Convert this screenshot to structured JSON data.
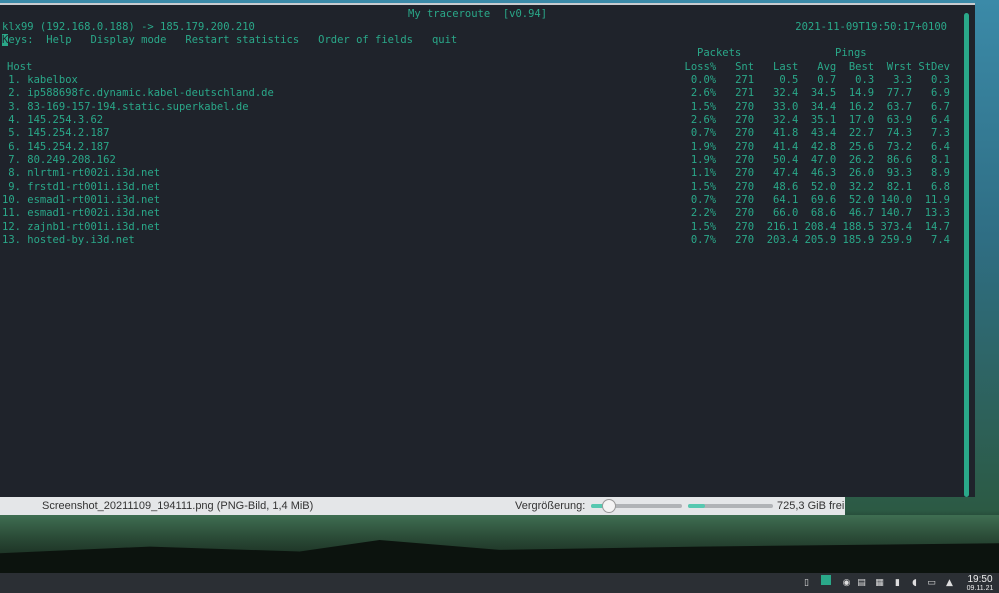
{
  "terminal": {
    "title": "My traceroute  [v0.94]",
    "route": "klx99 (192.168.0.188) -> 185.179.200.210",
    "timestamp": "2021-11-09T19:50:17+0100",
    "keys_cursor": "K",
    "keys_label": "eys:",
    "keys": [
      "Help",
      "Display mode",
      "Restart statistics",
      "Order of fields",
      "quit"
    ],
    "group_headers": {
      "packets": "Packets",
      "pings": "Pings"
    },
    "columns": {
      "host": "Host",
      "loss": "Loss%",
      "snt": "Snt",
      "last": "Last",
      "avg": "Avg",
      "best": "Best",
      "wrst": "Wrst",
      "stdev": "StDev"
    },
    "rows": [
      {
        "n": "1.",
        "host": "kabelbox",
        "loss": "0.0%",
        "snt": "271",
        "last": "0.5",
        "avg": "0.7",
        "best": "0.3",
        "wrst": "3.3",
        "stdev": "0.3"
      },
      {
        "n": "2.",
        "host": "ip588698fc.dynamic.kabel-deutschland.de",
        "loss": "2.6%",
        "snt": "271",
        "last": "32.4",
        "avg": "34.5",
        "best": "14.9",
        "wrst": "77.7",
        "stdev": "6.9"
      },
      {
        "n": "3.",
        "host": "83-169-157-194.static.superkabel.de",
        "loss": "1.5%",
        "snt": "270",
        "last": "33.0",
        "avg": "34.4",
        "best": "16.2",
        "wrst": "63.7",
        "stdev": "6.7"
      },
      {
        "n": "4.",
        "host": "145.254.3.62",
        "loss": "2.6%",
        "snt": "270",
        "last": "32.4",
        "avg": "35.1",
        "best": "17.0",
        "wrst": "63.9",
        "stdev": "6.4"
      },
      {
        "n": "5.",
        "host": "145.254.2.187",
        "loss": "0.7%",
        "snt": "270",
        "last": "41.8",
        "avg": "43.4",
        "best": "22.7",
        "wrst": "74.3",
        "stdev": "7.3"
      },
      {
        "n": "6.",
        "host": "145.254.2.187",
        "loss": "1.9%",
        "snt": "270",
        "last": "41.4",
        "avg": "42.8",
        "best": "25.6",
        "wrst": "73.2",
        "stdev": "6.4"
      },
      {
        "n": "7.",
        "host": "80.249.208.162",
        "loss": "1.9%",
        "snt": "270",
        "last": "50.4",
        "avg": "47.0",
        "best": "26.2",
        "wrst": "86.6",
        "stdev": "8.1"
      },
      {
        "n": "8.",
        "host": "nlrtm1-rt002i.i3d.net",
        "loss": "1.1%",
        "snt": "270",
        "last": "47.4",
        "avg": "46.3",
        "best": "26.0",
        "wrst": "93.3",
        "stdev": "8.9"
      },
      {
        "n": "9.",
        "host": "frstd1-rt001i.i3d.net",
        "loss": "1.5%",
        "snt": "270",
        "last": "48.6",
        "avg": "52.0",
        "best": "32.2",
        "wrst": "82.1",
        "stdev": "6.8"
      },
      {
        "n": "10.",
        "host": "esmad1-rt001i.i3d.net",
        "loss": "0.7%",
        "snt": "270",
        "last": "64.1",
        "avg": "69.6",
        "best": "52.0",
        "wrst": "140.0",
        "stdev": "11.9"
      },
      {
        "n": "11.",
        "host": "esmad1-rt002i.i3d.net",
        "loss": "2.2%",
        "snt": "270",
        "last": "66.0",
        "avg": "68.6",
        "best": "46.7",
        "wrst": "140.7",
        "stdev": "13.3"
      },
      {
        "n": "12.",
        "host": "zajnb1-rt001i.i3d.net",
        "loss": "1.5%",
        "snt": "270",
        "last": "216.1",
        "avg": "208.4",
        "best": "188.5",
        "wrst": "373.4",
        "stdev": "14.7"
      },
      {
        "n": "13.",
        "host": "hosted-by.i3d.net",
        "loss": "0.7%",
        "snt": "270",
        "last": "203.4",
        "avg": "205.9",
        "best": "185.9",
        "wrst": "259.9",
        "stdev": "7.4"
      }
    ]
  },
  "statusbar": {
    "file": "Screenshot_20211109_194111.png (PNG-Bild, 1,4 MiB)",
    "zoom_label": "Vergrößerung:",
    "zoom_fraction": 0.2,
    "disk_fraction": 0.2,
    "free": "725,3 GiB frei"
  },
  "taskbar": {
    "time": "19:50",
    "date": "09.11.21"
  },
  "colors": {
    "terminal_fg": "#2aa889",
    "terminal_bg": "#1f232b"
  }
}
